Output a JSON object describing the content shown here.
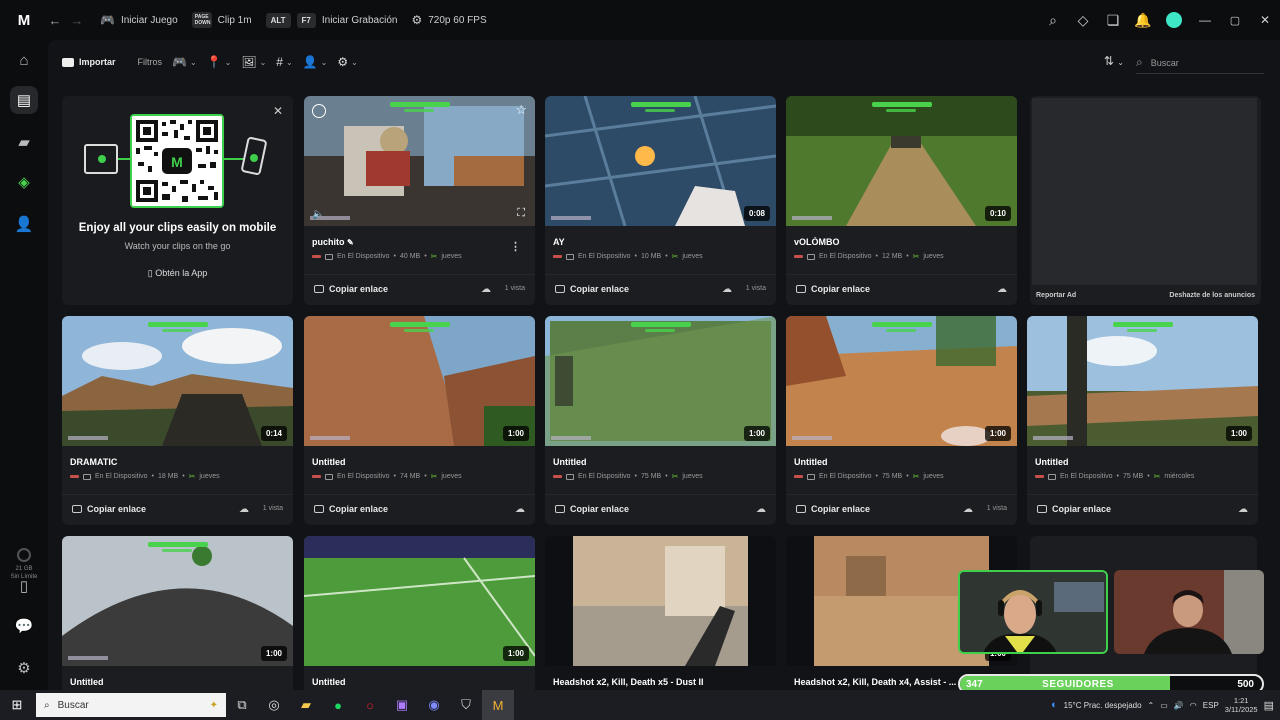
{
  "titlebar": {
    "logo": "M",
    "items": [
      {
        "kbd": "",
        "label": "Iniciar Juego"
      },
      {
        "kbd": "PAGE DOWN",
        "label": "Clip 1m"
      },
      {
        "kbd": "ALT",
        "kbd2": "F7",
        "label": "Iniciar Grabación"
      },
      {
        "kbd": "",
        "label": "720p 60 FPS"
      }
    ]
  },
  "toolbar": {
    "import_label": "Importar",
    "filters_label": "Filtros",
    "search_placeholder": "Buscar"
  },
  "sidebar": {
    "storage_used": "21 GB",
    "storage_limit": "Sin Límite"
  },
  "mobile_promo": {
    "title": "Enjoy all your clips easily on mobile",
    "subtitle": "Watch your clips on the go",
    "cta": "Obtén la App"
  },
  "copy_label": "Copiar enlace",
  "clips": [
    {
      "title": "puchito",
      "location": "En El Dispositivo",
      "size": "40 MB",
      "day": "jueves",
      "views": "1 vista",
      "duration": "",
      "thumb": "truck",
      "editable": true
    },
    {
      "title": "AY",
      "location": "En El Dispositivo",
      "size": "10 MB",
      "day": "jueves",
      "views": "1 vista",
      "duration": "0:08",
      "thumb": "blue"
    },
    {
      "title": "vOLÓMBO",
      "location": "En El Dispositivo",
      "size": "12 MB",
      "day": "jueves",
      "views": "",
      "duration": "0:10",
      "thumb": "forest"
    },
    {
      "title": "DRAMATIC",
      "location": "En El Dispositivo",
      "size": "18 MB",
      "day": "jueves",
      "views": "1 vista",
      "duration": "0:14",
      "thumb": "sky"
    },
    {
      "title": "Untitled",
      "location": "En El Dispositivo",
      "size": "74 MB",
      "day": "jueves",
      "views": "",
      "duration": "1:00",
      "thumb": "cliff"
    },
    {
      "title": "Untitled",
      "location": "En El Dispositivo",
      "size": "75 MB",
      "day": "jueves",
      "views": "",
      "duration": "1:00",
      "thumb": "greenwin"
    },
    {
      "title": "Untitled",
      "location": "En El Dispositivo",
      "size": "75 MB",
      "day": "jueves",
      "views": "1 vista",
      "duration": "1:00",
      "thumb": "desert"
    },
    {
      "title": "Untitled",
      "location": "En El Dispositivo",
      "size": "75 MB",
      "day": "miércoles",
      "views": "",
      "duration": "1:00",
      "thumb": "sky2"
    },
    {
      "title": "Untitled",
      "location": "",
      "size": "",
      "day": "",
      "views": "",
      "duration": "1:00",
      "thumb": "hill"
    },
    {
      "title": "Untitled",
      "location": "",
      "size": "",
      "day": "",
      "views": "",
      "duration": "1:00",
      "thumb": "soccer"
    },
    {
      "title": "Headshot x2, Kill, Death x5 - Dust II",
      "location": "",
      "size": "",
      "day": "",
      "views": "",
      "duration": "",
      "thumb": "cs"
    },
    {
      "title": "Headshot x2, Kill, Death x4, Assist - ...",
      "location": "",
      "size": "",
      "day": "",
      "views": "",
      "duration": "1:00",
      "thumb": "cs2"
    }
  ],
  "ad": {
    "report": "Reportar Ad",
    "hide": "Deshazte de los anuncios"
  },
  "followers": {
    "current": "347",
    "label": "SEGUIDORES",
    "goal": "500",
    "progress": 0.694
  },
  "taskbar": {
    "search_placeholder": "Buscar",
    "weather": "15°C  Prac. despejado",
    "lang": "ESP",
    "time": "1:21",
    "date": "3/11/2025"
  }
}
